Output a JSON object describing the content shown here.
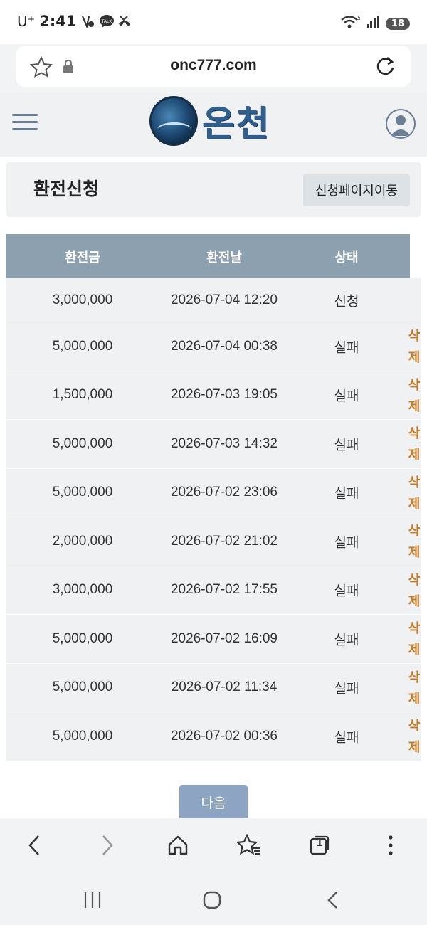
{
  "status_bar": {
    "carrier": "U⁺",
    "time": "2:41",
    "battery": "18",
    "notif_icons": [
      "vpn-key-icon",
      "talk-icon",
      "missed-call-icon"
    ]
  },
  "browser": {
    "url": "onc777.com",
    "tab_count": "1"
  },
  "site": {
    "logo_text": "온천"
  },
  "page": {
    "title": "환전신청",
    "go_apply_label": "신청페이지이동"
  },
  "table": {
    "headers": {
      "amount": "환전금",
      "date": "환전날",
      "status": "상태"
    },
    "delete_label": [
      "삭",
      "제"
    ],
    "rows": [
      {
        "amount": "3,000,000",
        "date": "2026-07-04 12:20",
        "status": "신청"
      },
      {
        "amount": "5,000,000",
        "date": "2026-07-04 00:38",
        "status": "실패"
      },
      {
        "amount": "1,500,000",
        "date": "2026-07-03 19:05",
        "status": "실패"
      },
      {
        "amount": "5,000,000",
        "date": "2026-07-03 14:32",
        "status": "실패"
      },
      {
        "amount": "5,000,000",
        "date": "2026-07-02 23:06",
        "status": "실패"
      },
      {
        "amount": "2,000,000",
        "date": "2026-07-02 21:02",
        "status": "실패"
      },
      {
        "amount": "3,000,000",
        "date": "2026-07-02 17:55",
        "status": "실패"
      },
      {
        "amount": "5,000,000",
        "date": "2026-07-02 16:09",
        "status": "실패"
      },
      {
        "amount": "5,000,000",
        "date": "2026-07-02 11:34",
        "status": "실패"
      },
      {
        "amount": "5,000,000",
        "date": "2026-07-02 00:36",
        "status": "실패"
      }
    ]
  },
  "pagination": {
    "next_label": "다음"
  },
  "colors": {
    "header_bg": "#8da0b0",
    "row_bg": "#f0f1f3",
    "delete": "#c57b24",
    "next_btn": "#8da5c2",
    "logo": "#2f5f8e"
  }
}
